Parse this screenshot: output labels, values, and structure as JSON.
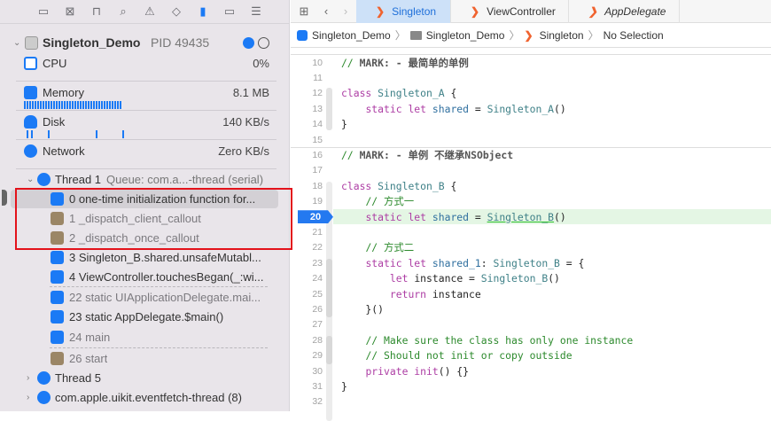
{
  "navigator": {
    "toolbar_icons": [
      "folder-icon",
      "source-control-icon",
      "hierarchy-icon",
      "search-icon",
      "warning-icon",
      "test-icon",
      "debug-icon",
      "breakpoint-icon",
      "report-icon"
    ],
    "process": {
      "name": "Singleton_Demo",
      "pid": "PID 49435"
    },
    "gauges": [
      {
        "label": "CPU",
        "value": "0%"
      },
      {
        "label": "Memory",
        "value": "8.1 MB"
      },
      {
        "label": "Disk",
        "value": "140 KB/s"
      },
      {
        "label": "Network",
        "value": "Zero KB/s"
      }
    ],
    "thread1": {
      "label": "Thread 1",
      "queue": "Queue: com.a...-thread (serial)"
    },
    "frames": [
      {
        "text": "0 one-time initialization function for...",
        "kind": "user",
        "dim": false,
        "selected": true
      },
      {
        "text": "1 _dispatch_client_callout",
        "kind": "lib",
        "dim": true
      },
      {
        "text": "2 _dispatch_once_callout",
        "kind": "lib",
        "dim": true
      },
      {
        "text": "3 Singleton_B.shared.unsafeMutabl...",
        "kind": "user",
        "dim": false
      },
      {
        "text": "4 ViewController.touchesBegan(_:wi...",
        "kind": "user",
        "dim": false
      },
      {
        "text": "22 static UIApplicationDelegate.mai...",
        "kind": "user",
        "dim": true
      },
      {
        "text": "23 static AppDelegate.$main()",
        "kind": "user",
        "dim": false
      },
      {
        "text": "24 main",
        "kind": "user",
        "dim": true
      },
      {
        "text": "26 start",
        "kind": "lib",
        "dim": true
      }
    ],
    "other_threads": [
      "Thread 5",
      "com.apple.uikit.eventfetch-thread (8)"
    ]
  },
  "editor": {
    "tabs": [
      {
        "label": "Singleton",
        "active": true
      },
      {
        "label": "ViewController"
      },
      {
        "label": "AppDelegate"
      }
    ],
    "breadcrumb": [
      "Singleton_Demo",
      "Singleton_Demo",
      "Singleton",
      "No Selection"
    ],
    "current_line": 20,
    "lines": [
      {
        "n": 10,
        "t": [
          [
            "cm",
            "// "
          ],
          [
            "mk",
            "MARK: - 最简单的单例"
          ]
        ]
      },
      {
        "n": 11,
        "t": []
      },
      {
        "n": 12,
        "t": [
          [
            "kw",
            "class "
          ],
          [
            "ty",
            "Singleton_A"
          ],
          [
            "pl",
            " {"
          ]
        ]
      },
      {
        "n": 13,
        "t": [
          [
            "pl",
            "    "
          ],
          [
            "kw",
            "static let "
          ],
          [
            "id",
            "shared"
          ],
          [
            "pl",
            " = "
          ],
          [
            "ty",
            "Singleton_A"
          ],
          [
            "pl",
            "()"
          ]
        ]
      },
      {
        "n": 14,
        "t": [
          [
            "pl",
            "}"
          ]
        ]
      },
      {
        "n": 15,
        "t": []
      },
      {
        "n": 16,
        "t": [
          [
            "cm",
            "// "
          ],
          [
            "mk",
            "MARK: - 单例 不继承NSObject"
          ]
        ]
      },
      {
        "n": 17,
        "t": []
      },
      {
        "n": 18,
        "t": [
          [
            "kw",
            "class "
          ],
          [
            "ty",
            "Singleton_B"
          ],
          [
            "pl",
            " {"
          ]
        ]
      },
      {
        "n": 19,
        "t": [
          [
            "pl",
            "    "
          ],
          [
            "cm",
            "// 方式一"
          ]
        ]
      },
      {
        "n": 20,
        "t": [
          [
            "pl",
            "    "
          ],
          [
            "kw",
            "static let "
          ],
          [
            "id",
            "shared"
          ],
          [
            "pl",
            " = "
          ],
          [
            "ty",
            "Singleton_B"
          ],
          [
            "pl",
            "()"
          ]
        ]
      },
      {
        "n": 21,
        "t": []
      },
      {
        "n": 22,
        "t": [
          [
            "pl",
            "    "
          ],
          [
            "cm",
            "// 方式二"
          ]
        ]
      },
      {
        "n": 23,
        "t": [
          [
            "pl",
            "    "
          ],
          [
            "kw",
            "static let "
          ],
          [
            "id",
            "shared_1"
          ],
          [
            "pl",
            ": "
          ],
          [
            "ty",
            "Singleton_B"
          ],
          [
            "pl",
            " = {"
          ]
        ]
      },
      {
        "n": 24,
        "t": [
          [
            "pl",
            "        "
          ],
          [
            "kw",
            "let "
          ],
          [
            "pl",
            "instance = "
          ],
          [
            "ty",
            "Singleton_B"
          ],
          [
            "pl",
            "()"
          ]
        ]
      },
      {
        "n": 25,
        "t": [
          [
            "pl",
            "        "
          ],
          [
            "kw",
            "return "
          ],
          [
            "pl",
            "instance"
          ]
        ]
      },
      {
        "n": 26,
        "t": [
          [
            "pl",
            "    }()"
          ]
        ]
      },
      {
        "n": 27,
        "t": []
      },
      {
        "n": 28,
        "t": [
          [
            "pl",
            "    "
          ],
          [
            "cm",
            "// Make sure the class has only one instance"
          ]
        ]
      },
      {
        "n": 29,
        "t": [
          [
            "pl",
            "    "
          ],
          [
            "cm",
            "// Should not init or copy outside"
          ]
        ]
      },
      {
        "n": 30,
        "t": [
          [
            "pl",
            "    "
          ],
          [
            "kw",
            "private init"
          ],
          [
            "pl",
            "() {}"
          ]
        ]
      },
      {
        "n": 31,
        "t": [
          [
            "pl",
            "}"
          ]
        ]
      },
      {
        "n": 32,
        "t": []
      }
    ]
  }
}
